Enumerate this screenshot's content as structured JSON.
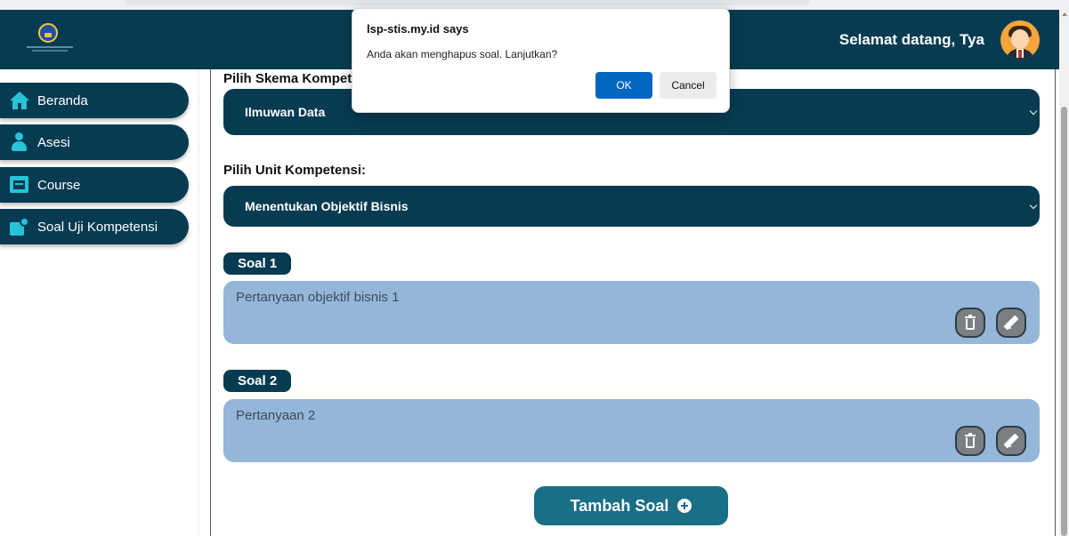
{
  "header": {
    "greeting": "Selamat datang, Tya"
  },
  "sidebar": {
    "items": [
      {
        "label": "Beranda",
        "icon": "home-icon"
      },
      {
        "label": "Asesi",
        "icon": "person-icon"
      },
      {
        "label": "Course",
        "icon": "course-icon"
      },
      {
        "label": "Soal Uji Kompetensi",
        "icon": "exam-icon"
      }
    ]
  },
  "main": {
    "skema_label": "Pilih Skema Kompetensi:",
    "skema_value": "Ilmuwan Data",
    "unit_label": "Pilih Unit Kompetensi:",
    "unit_value": "Menentukan Objektif Bisnis",
    "questions": [
      {
        "badge": "Soal 1",
        "text": "Pertanyaan objektif bisnis 1"
      },
      {
        "badge": "Soal 2",
        "text": "Pertanyaan 2"
      }
    ],
    "add_button": "Tambah Soal"
  },
  "dialog": {
    "title": "lsp-stis.my.id says",
    "message": "Anda akan menghapus soal. Lanjutkan?",
    "ok": "OK",
    "cancel": "Cancel"
  },
  "colors": {
    "primary_dark": "#073b52",
    "accent_cyan": "#29c3d8",
    "question_card": "#94b6d9",
    "add_button": "#1a6e86",
    "dialog_ok": "#0067c0"
  }
}
